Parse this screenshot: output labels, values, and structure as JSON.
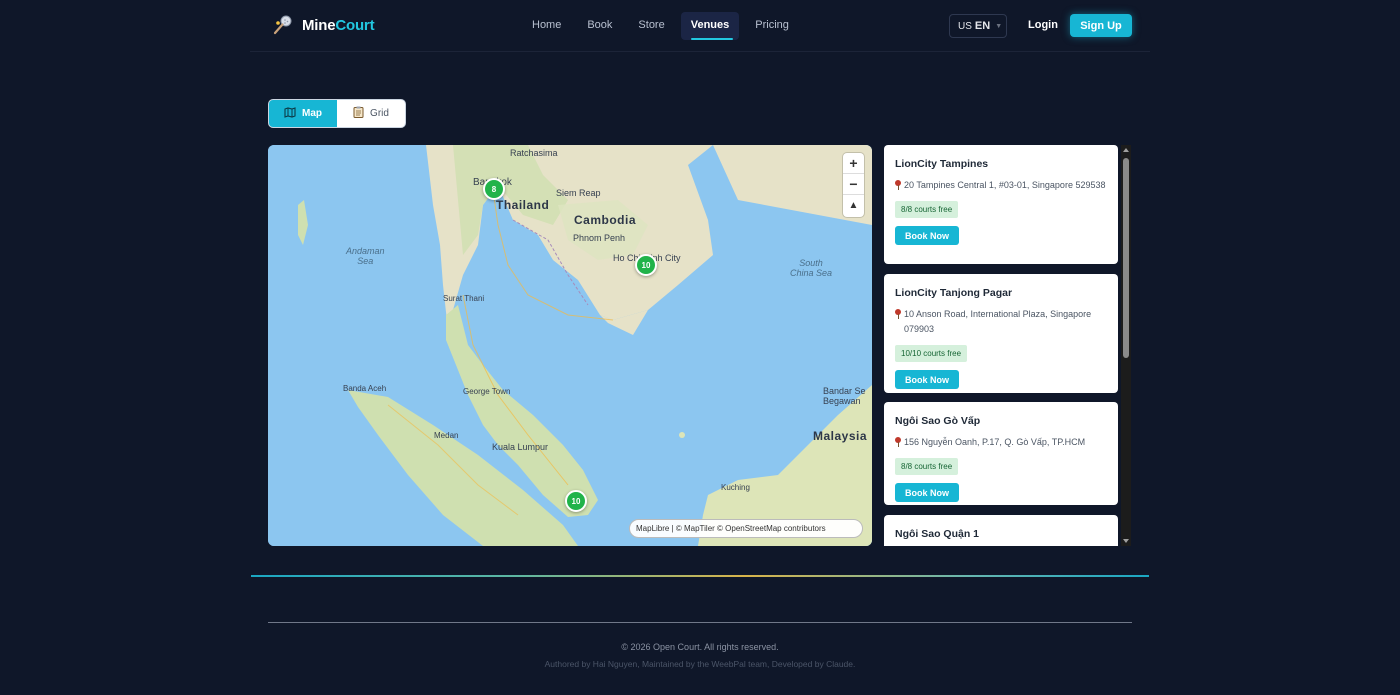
{
  "header": {
    "brand_prefix": "Mine",
    "brand_suffix": "Court",
    "nav": [
      {
        "label": "Home",
        "active": false
      },
      {
        "label": "Book",
        "active": false
      },
      {
        "label": "Store",
        "active": false
      },
      {
        "label": "Venues",
        "active": true
      },
      {
        "label": "Pricing",
        "active": false
      }
    ],
    "lang_flag": "US",
    "lang_code": "EN",
    "login_label": "Login",
    "signup_label": "Sign Up",
    "accent_color": "#17b6d4"
  },
  "view_toggle": {
    "map_label": "Map",
    "grid_label": "Grid",
    "active": "map",
    "map_icon": "map-icon",
    "grid_icon": "clipboard-icon"
  },
  "map": {
    "labels": {
      "ratchasima": "Ratchasima",
      "bangkok": "Bangkok",
      "thailand": "Thailand",
      "siem_reap": "Siem Reap",
      "cambodia": "Cambodia",
      "phnom_penh": "Phnom Penh",
      "ho_chi_minh": "Ho Chi Minh City",
      "andaman_1": "Andaman",
      "andaman_2": "Sea",
      "south_china_1": "South",
      "south_china_2": "China Sea",
      "surat_thani": "Surat Thani",
      "banda_aceh": "Banda Aceh",
      "george_town": "George Town",
      "bandar_1": "Bandar Se",
      "bandar_2": "Begawan",
      "medan": "Medan",
      "kuala_lumpur": "Kuala Lumpur",
      "malaysia": "Malaysia",
      "kuching": "Kuching"
    },
    "clusters": [
      {
        "count": "8"
      },
      {
        "count": "10"
      },
      {
        "count": "10"
      }
    ],
    "zoom_in": "+",
    "zoom_out": "−",
    "reset_north": "▲",
    "attribution": "MapLibre | © MapTiler © OpenStreetMap contributors"
  },
  "venues": [
    {
      "name": "LionCity Tampines",
      "address": "20 Tampines Central 1, #03-01, Singapore 529538",
      "courts": "8/8 courts free",
      "button": "Book Now"
    },
    {
      "name": "LionCity Tanjong Pagar",
      "address": "10 Anson Road, International Plaza, Singapore 079903",
      "courts": "10/10 courts free",
      "button": "Book Now"
    },
    {
      "name": "Ngôi Sao Gò Vấp",
      "address": "156 Nguyễn Oanh, P.17, Q. Gò Vấp, TP.HCM",
      "courts": "8/8 courts free",
      "button": "Book Now"
    },
    {
      "name": "Ngôi Sao Quận 1",
      "address": "",
      "courts": "",
      "button": ""
    }
  ],
  "footer": {
    "copyright": "© 2026 Open Court. All rights reserved.",
    "authored": "Authored by Hai Nguyen, Maintained by the WeebPal team, Developed by Claude."
  }
}
